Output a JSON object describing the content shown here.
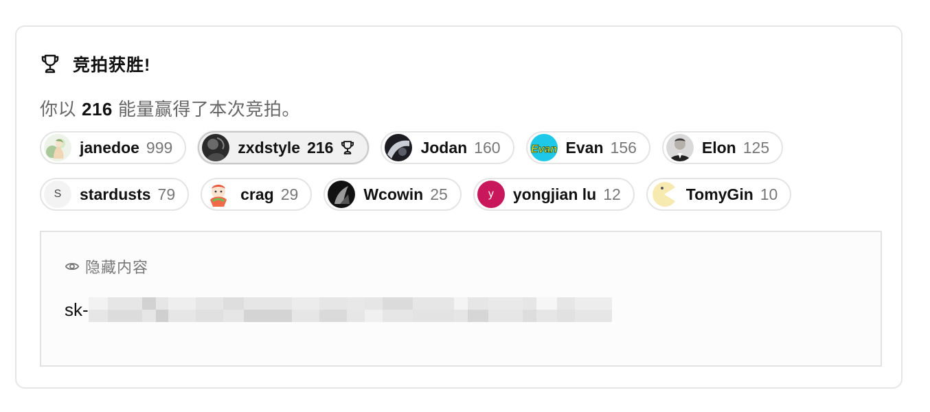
{
  "header": {
    "icon": "trophy-icon",
    "title": "竞拍获胜!"
  },
  "summary": {
    "prefix": "你以",
    "amount": "216",
    "suffix": "能量赢得了本次竞拍。"
  },
  "bidders": [
    {
      "name": "janedoe",
      "score": "999",
      "avatar": "illustrated-avatar"
    },
    {
      "name": "zxdstyle",
      "score": "216",
      "avatar": "photo-avatar",
      "winner": true,
      "badge_icon": "trophy-icon"
    },
    {
      "name": "Jodan",
      "score": "160",
      "avatar": "photo-avatar"
    },
    {
      "name": "Evan",
      "score": "156",
      "avatar": "evan-logo-avatar",
      "avatar_text": "Evan"
    },
    {
      "name": "Elon",
      "score": "125",
      "avatar": "photo-avatar"
    },
    {
      "name": "stardusts",
      "score": "79",
      "avatar": "letter-avatar",
      "avatar_text": "S"
    },
    {
      "name": "crag",
      "score": "29",
      "avatar": "cartoon-avatar"
    },
    {
      "name": "Wcowin",
      "score": "25",
      "avatar": "photo-avatar"
    },
    {
      "name": "yongjian lu",
      "score": "12",
      "avatar": "letter-avatar",
      "avatar_text": "Y"
    },
    {
      "name": "TomyGin",
      "score": "10",
      "avatar": "pacman-avatar"
    }
  ],
  "hidden_content": {
    "icon": "eye-icon",
    "label": "隐藏内容",
    "secret_prefix": "sk-"
  },
  "colors": {
    "yongjian_avatar_bg": "#c8175a",
    "evan_avatar_bg": "#1ec8e8",
    "evan_logo_text": "#e4f23a",
    "tomygin_avatar_bg": "#f7eab0"
  }
}
